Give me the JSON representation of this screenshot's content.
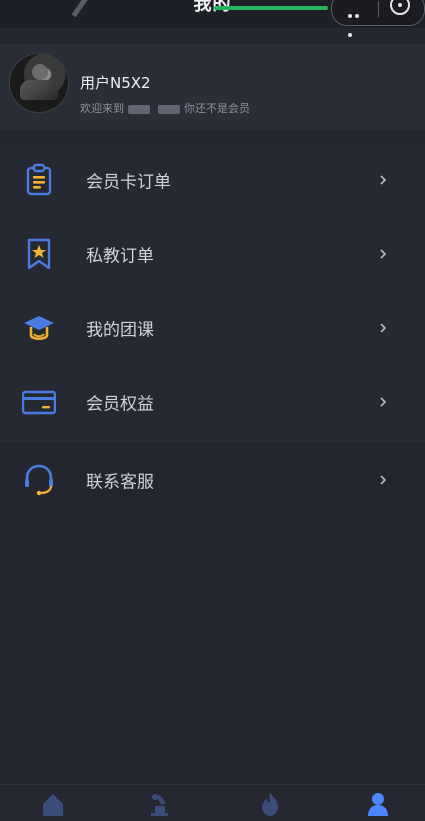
{
  "nav": {
    "title": "我的"
  },
  "profile": {
    "username": "用户N5X2",
    "welcome_prefix": "欢迎来到",
    "welcome_suffix": "你还不是会员"
  },
  "menu": [
    {
      "label": "会员卡订单"
    },
    {
      "label": "私教订单"
    },
    {
      "label": "我的团课"
    },
    {
      "label": "会员权益"
    },
    {
      "label": "联系客服"
    }
  ],
  "tabbar": {
    "items": [
      {
        "icon": "home-icon",
        "active": false
      },
      {
        "icon": "training-icon",
        "active": false
      },
      {
        "icon": "flame-icon",
        "active": false
      },
      {
        "icon": "user-icon",
        "active": true
      }
    ]
  }
}
